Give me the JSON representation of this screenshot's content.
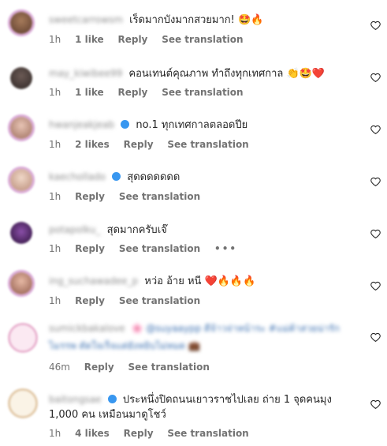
{
  "comments": [
    {
      "username": "sweetcarrowsm",
      "verified": false,
      "text": "เร็ดมากบังมากสวยมาก! 🤩🔥",
      "time": "1h",
      "likes": "1 like",
      "reply": "Reply",
      "translate": "See translation",
      "more": ""
    },
    {
      "username": "may_kiwibee99",
      "verified": false,
      "text": "คอนเทนต์คุณภาพ ทำถึงทุกเทศกาล 👏🤩❤️",
      "time": "1h",
      "likes": "1 like",
      "reply": "Reply",
      "translate": "See translation",
      "more": ""
    },
    {
      "username": "hwanjeakjeab",
      "verified": true,
      "text": "no.1 ทุกเทศกาลตลอดปีย",
      "time": "1h",
      "likes": "2 likes",
      "reply": "Reply",
      "translate": "See translation",
      "more": ""
    },
    {
      "username": "kaechollado",
      "verified": true,
      "text": "สุดดดดดดด",
      "time": "1h",
      "likes": "",
      "reply": "Reply",
      "translate": "See translation",
      "more": ""
    },
    {
      "username": "potapolku_",
      "verified": false,
      "text": "สุดมากครับเจ๊",
      "time": "1h",
      "likes": "",
      "reply": "Reply",
      "translate": "See translation",
      "more": "•••"
    },
    {
      "username": "ing_suchawadee_p",
      "verified": false,
      "text": "หว่อ อ้าย หนี ❤️🔥🔥🔥",
      "time": "1h",
      "likes": "",
      "reply": "Reply",
      "translate": "See translation",
      "more": ""
    },
    {
      "username": "sumickbakalove",
      "verified": false,
      "text": "🌸 @suyaaypp ดีจ้าวจ่าหน้าระ #แม่ค้าสวยน่ารัก",
      "text2": "ไมรรพ ตัดใจเร็จแต่ยังหยิบไม่หมด 💼",
      "time": "46m",
      "likes": "",
      "reply": "Reply",
      "translate": "See translation",
      "more": ""
    },
    {
      "username": "baitongsae",
      "verified": true,
      "text": "ประหนึ่งปิดถนนเยาวราชไปเลย ถ่าย 1 จุดคนมุง",
      "text2": "1,000 คน เหมือนมาดูโชว์",
      "time": "1h",
      "likes": "4 likes",
      "reply": "Reply",
      "translate": "See translation",
      "more": ""
    }
  ],
  "colors": {
    "avatar_ring": "#d9a8d6",
    "verified": "#3897f0",
    "meta": "#737373"
  }
}
